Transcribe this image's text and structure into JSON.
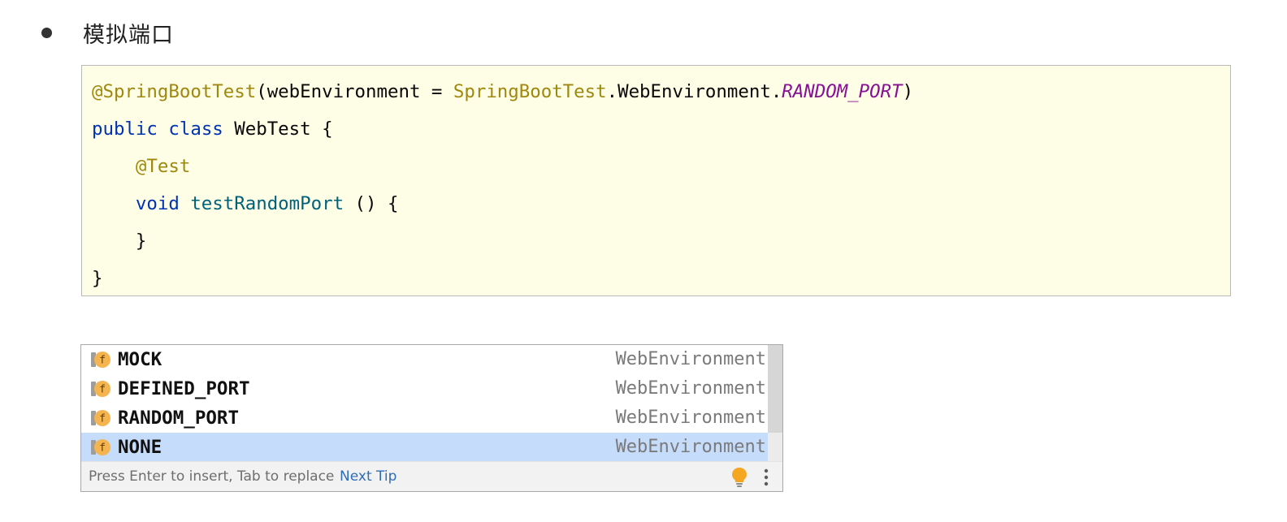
{
  "bullet": {
    "text": "模拟端口"
  },
  "code": {
    "line1": {
      "annotation": "@SpringBootTest",
      "open": "(webEnvironment = ",
      "class_ref": "SpringBootTest",
      "middle": ".WebEnvironment.",
      "constant": "RANDOM_PORT",
      "close": ")"
    },
    "line2": {
      "kw_public": "public",
      "kw_class": "class",
      "rest": " WebTest {"
    },
    "line3": {
      "annotation": "@Test"
    },
    "line4": {
      "kw_void": "void",
      "method": "testRandomPort",
      "rest": " () {"
    },
    "line5": {
      "text": "}"
    },
    "line6": {
      "text": "}"
    }
  },
  "completion": {
    "items": [
      {
        "name": "MOCK",
        "type": "WebEnvironment",
        "icon": "field-f-icon",
        "selected": false
      },
      {
        "name": "DEFINED_PORT",
        "type": "WebEnvironment",
        "icon": "field-f-icon",
        "selected": false
      },
      {
        "name": "RANDOM_PORT",
        "type": "WebEnvironment",
        "icon": "field-f-icon",
        "selected": false
      },
      {
        "name": "NONE",
        "type": "WebEnvironment",
        "icon": "field-f-icon",
        "selected": true
      }
    ],
    "footer": {
      "hint": "Press Enter to insert, Tab to replace",
      "link": "Next Tip",
      "bulb_icon": "lightbulb-icon",
      "more_icon": "more-vertical-icon"
    }
  },
  "colors": {
    "code_background": "#fefde6",
    "annotation": "#9e880d",
    "keyword": "#0033b3",
    "constant": "#871094",
    "method": "#00627a",
    "selection": "#c6dcfb",
    "link": "#2f6db5",
    "bulb": "#f5a623"
  }
}
